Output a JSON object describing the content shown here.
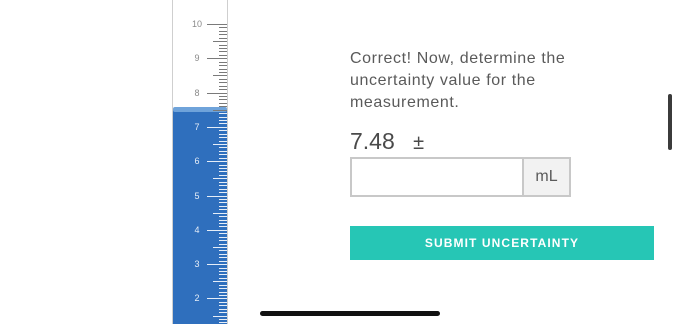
{
  "cylinder": {
    "scale_labels": [
      "10",
      "9",
      "8",
      "7",
      "6",
      "5",
      "4",
      "3",
      "2"
    ],
    "scale_max": 10,
    "scale_min": 2,
    "liquid_level_ml": 7.48,
    "colors": {
      "liquid": "#2f6fbd",
      "meniscus": "#6fa3da",
      "tick_above": "#7a7a7a",
      "tick_below": "#e6eef8",
      "label_above": "#8a8a8a",
      "label_below": "#e6eef8"
    }
  },
  "question": {
    "prompt": "Correct! Now, determine the uncertainty value for the measurement.",
    "measurement_value": "7.48",
    "plus_minus": "±",
    "input_value": "",
    "input_placeholder": "",
    "unit": "mL"
  },
  "submit": {
    "label": "SUBMIT UNCERTAINTY",
    "color": "#26c6b5"
  }
}
